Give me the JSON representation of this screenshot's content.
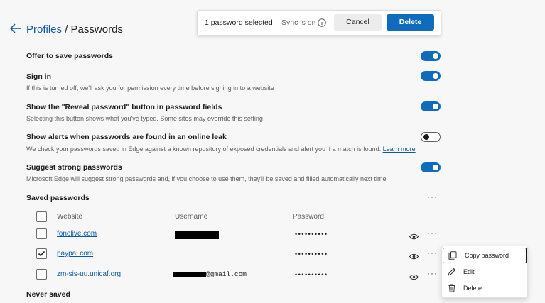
{
  "header": {
    "profiles_link": "Profiles",
    "separator": "/",
    "page_title": "Passwords"
  },
  "selection_bar": {
    "selected_text": "1 password selected",
    "sync_text": "Sync is on",
    "cancel_label": "Cancel",
    "delete_label": "Delete",
    "accent": "#0f6cbd"
  },
  "settings": [
    {
      "title": "Offer to save passwords",
      "description": "",
      "enabled": true
    },
    {
      "title": "Sign in",
      "description": "If this is turned off, we'll ask you for permission every time before signing in to a website",
      "enabled": true
    },
    {
      "title": "Show the \"Reveal password\" button in password fields",
      "description": "Selecting this button shows what you've typed. Some sites may override this setting",
      "enabled": true
    },
    {
      "title": "Show alerts when passwords are found in an online leak",
      "description": "We check your passwords saved in Edge against a known repository of exposed credentials and alert you if a match is found.",
      "link": "Learn more",
      "enabled": false
    },
    {
      "title": "Suggest strong passwords",
      "description": "Microsoft Edge will suggest strong passwords and, if you choose to use them, they'll be saved and filled automatically next time",
      "enabled": true
    }
  ],
  "saved_passwords": {
    "heading": "Saved passwords",
    "columns": {
      "website": "Website",
      "username": "Username",
      "password": "Password"
    },
    "rows": [
      {
        "website": "fonolive.com",
        "username": "",
        "password_mask": "••••••••••",
        "selected": false
      },
      {
        "website": "paypal.com",
        "username": "",
        "password_mask": "••••••••••",
        "selected": true
      },
      {
        "website": "zm-sis-uu.unicaf.org",
        "username": "@gmail.com",
        "password_mask": "••••••••••",
        "selected": false
      }
    ]
  },
  "context_menu": {
    "items": [
      {
        "label": "Copy password",
        "icon": "copy-icon"
      },
      {
        "label": "Edit",
        "icon": "pencil-icon"
      },
      {
        "label": "Delete",
        "icon": "trash-icon"
      }
    ]
  },
  "never_saved": {
    "heading": "Never saved"
  }
}
